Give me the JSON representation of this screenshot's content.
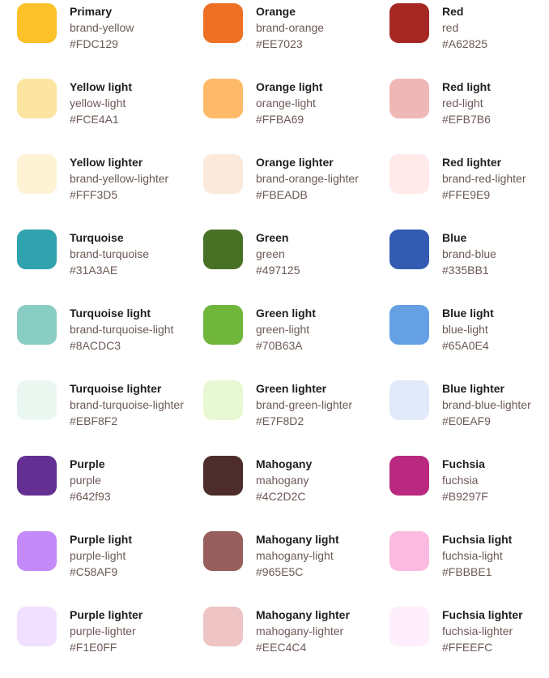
{
  "swatches": [
    {
      "name": "Primary",
      "token": "brand-yellow",
      "hex": "#FDC129",
      "color": "#FDC129"
    },
    {
      "name": "Orange",
      "token": "brand-orange",
      "hex": "#EE7023",
      "color": "#EE7023"
    },
    {
      "name": "Red",
      "token": "red",
      "hex": "#A62825",
      "color": "#A62825"
    },
    {
      "name": "Yellow light",
      "token": "yellow-light",
      "hex": "#FCE4A1",
      "color": "#FCE4A1"
    },
    {
      "name": "Orange light",
      "token": "orange-light",
      "hex": "#FFBA69",
      "color": "#FFBA69"
    },
    {
      "name": "Red light",
      "token": "red-light",
      "hex": "#EFB7B6",
      "color": "#EFB7B6"
    },
    {
      "name": "Yellow lighter",
      "token": "brand-yellow-lighter",
      "hex": "#FFF3D5",
      "color": "#FFF3D5"
    },
    {
      "name": "Orange lighter",
      "token": "brand-orange-lighter",
      "hex": "#FBEADB",
      "color": "#FBEADB"
    },
    {
      "name": "Red lighter",
      "token": "brand-red-lighter",
      "hex": "#FFE9E9",
      "color": "#FFE9E9"
    },
    {
      "name": "Turquoise",
      "token": "brand-turquoise",
      "hex": "#31A3AE",
      "color": "#31A3AE"
    },
    {
      "name": "Green",
      "token": "green",
      "hex": "#497125",
      "color": "#497125"
    },
    {
      "name": "Blue",
      "token": "brand-blue",
      "hex": "#335BB1",
      "color": "#335BB1"
    },
    {
      "name": "Turquoise light",
      "token": "brand-turquoise-light",
      "hex": "#8ACDC3",
      "color": "#8ACDC3"
    },
    {
      "name": "Green light",
      "token": "green-light",
      "hex": "#70B63A",
      "color": "#70B63A"
    },
    {
      "name": "Blue light",
      "token": "blue-light",
      "hex": "#65A0E4",
      "color": "#65A0E4"
    },
    {
      "name": "Turquoise lighter",
      "token": "brand-turquoise-lighter",
      "hex": "#EBF8F2",
      "color": "#EBF8F2"
    },
    {
      "name": "Green lighter",
      "token": "brand-green-lighter",
      "hex": "#E7F8D2",
      "color": "#E7F8D2"
    },
    {
      "name": "Blue lighter",
      "token": "brand-blue-lighter",
      "hex": "#E0EAF9",
      "color": "#E0EAF9"
    },
    {
      "name": "Purple",
      "token": "purple",
      "hex": "#642f93",
      "color": "#642F93"
    },
    {
      "name": "Mahogany",
      "token": "mahogany",
      "hex": "#4C2D2C",
      "color": "#4C2D2C"
    },
    {
      "name": "Fuchsia",
      "token": "fuchsia",
      "hex": "#B9297F",
      "color": "#B9297F"
    },
    {
      "name": "Purple light",
      "token": "purple-light",
      "hex": "#C58AF9",
      "color": "#C58AF9"
    },
    {
      "name": "Mahogany light",
      "token": "mahogany-light",
      "hex": "#965E5C",
      "color": "#965E5C"
    },
    {
      "name": "Fuchsia light",
      "token": "fuchsia-light",
      "hex": "#FBBBE1",
      "color": "#FBBBE1"
    },
    {
      "name": "Purple lighter",
      "token": "purple-lighter",
      "hex": "#F1E0FF",
      "color": "#F1E0FF"
    },
    {
      "name": "Mahogany lighter",
      "token": "mahogany-lighter",
      "hex": "#EEC4C4",
      "color": "#EEC4C4"
    },
    {
      "name": "Fuchsia lighter",
      "token": "fuchsia-lighter",
      "hex": "#FFEEFC",
      "color": "#FFEEFC"
    }
  ]
}
